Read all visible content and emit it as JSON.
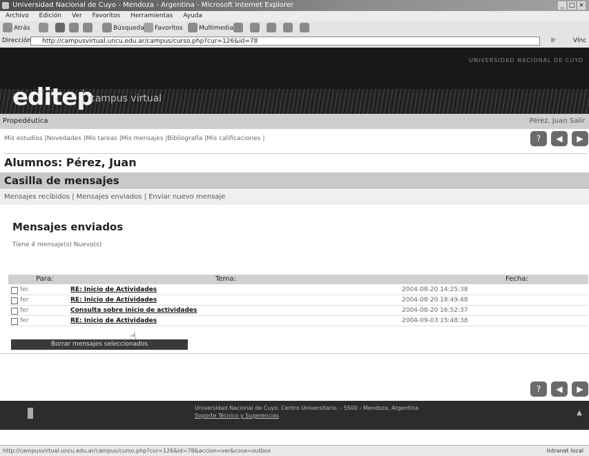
{
  "window": {
    "title": "Universidad Nacional de Cuyo - Mendoza - Argentina - Microsoft Internet Explorer"
  },
  "menu": [
    "Archivo",
    "Edición",
    "Ver",
    "Favoritos",
    "Herramientas",
    "Ayuda"
  ],
  "toolbar": {
    "back": "Atrás",
    "search": "Búsqueda",
    "favorites": "Favoritos",
    "multimedia": "Multimedia"
  },
  "address": {
    "label": "Dirección",
    "url": "http://campusvirtual.uncu.edu.ar/campus/curso.php?cur=126&id=78",
    "go": "Ir",
    "links": "Vínc"
  },
  "banner": {
    "university": "UNIVERSIDAD NACIONAL DE CUYO",
    "logo": "editep",
    "subtitle": "campus virtual"
  },
  "course": {
    "name": "Propedéutica",
    "user": "Pérez, Juan  Salir"
  },
  "nav": {
    "links": "Mis estudios |Novedades |Mis tareas |Mis mensajes |Bibliografía |Mis calificaciones |"
  },
  "page": {
    "alumnos": "Alumnos: Pérez, Juan",
    "casilla": "Casilla de mensajes",
    "tabs": "Mensajes recibidos | Mensajes enviados | Enviar nuevo mensaje",
    "heading": "Mensajes enviados",
    "count": "Tiene 4 mensaje(s) Nuevo(s)"
  },
  "table": {
    "headers": {
      "para": "Para:",
      "tema": "Tema:",
      "fecha": "Fecha:"
    },
    "rows": [
      {
        "para": "fer",
        "tema": "RE: Inicio de Actividades",
        "fecha": "2004-08-20 14:25:38"
      },
      {
        "para": "fer",
        "tema": "RE: Inicio de Actividades",
        "fecha": "2004-08-20 18:49:48"
      },
      {
        "para": "fer",
        "tema": "Consulta sobre inicio de actividades",
        "fecha": "2004-08-20 16:52:37"
      },
      {
        "para": "fer",
        "tema": "RE: Inicio de Actividades",
        "fecha": "2004-09-03 15:48:38"
      }
    ],
    "delete_button": "Borrar mensajes seleccionados"
  },
  "footer": {
    "address": "Universidad Nacional de Cuyo. Centro Universitario. - 5500 - Mendoza, Argentina",
    "link": "Soporte Técnico y Sugerencias"
  },
  "status": {
    "url": "http://campusvirtual.uncu.edu.ar/campus/curso.php?cur=126&id=78&accion=ver&cosa=outbox",
    "zone": "Intranet local"
  }
}
